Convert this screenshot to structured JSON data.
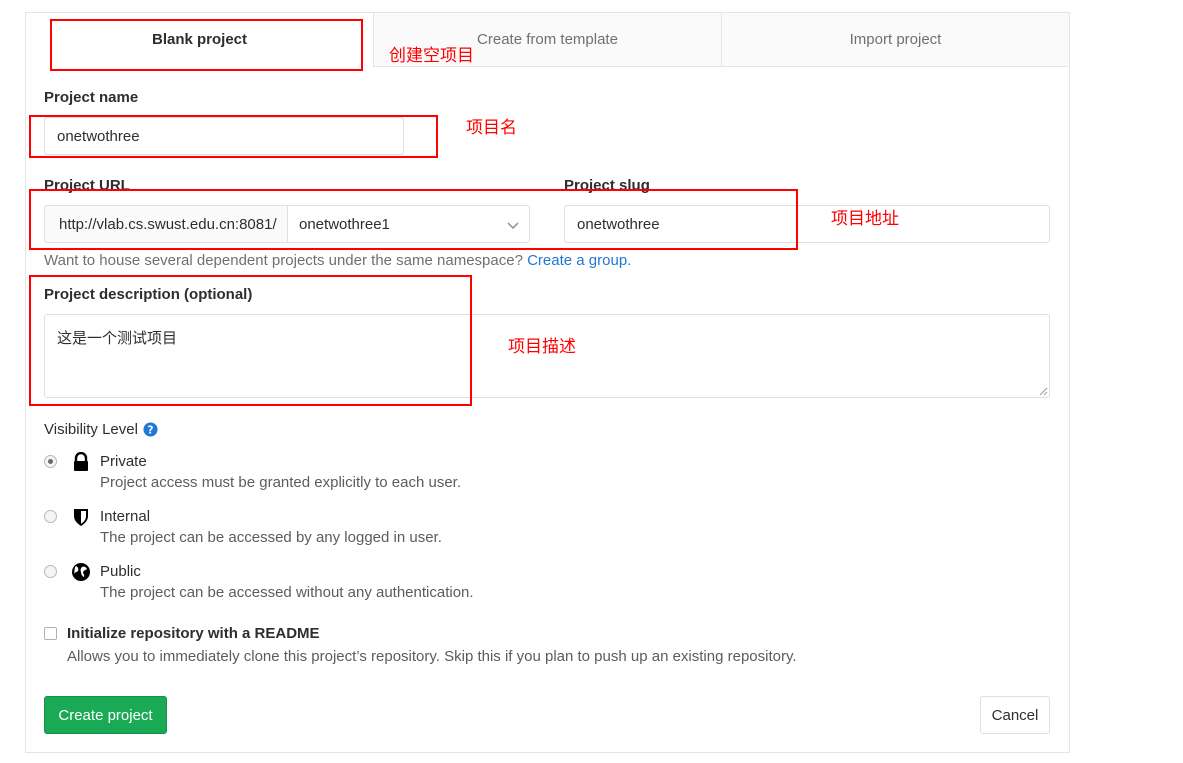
{
  "tabs": [
    {
      "label": "Blank project",
      "active": true
    },
    {
      "label": "Create from template",
      "active": false
    },
    {
      "label": "Import project",
      "active": false
    }
  ],
  "project_name": {
    "label": "Project name",
    "value": "onetwothree"
  },
  "project_url": {
    "label": "Project URL",
    "prefix": "http://vlab.cs.swust.edu.cn:8081/",
    "namespace": "onetwothree1"
  },
  "project_slug": {
    "label": "Project slug",
    "value": "onetwothree"
  },
  "namespace_help": {
    "text": "Want to house several dependent projects under the same namespace?",
    "link": "Create a group."
  },
  "description": {
    "label": "Project description (optional)",
    "value": "这是一个测试项目"
  },
  "visibility": {
    "label": "Visibility Level",
    "options": [
      {
        "title": "Private",
        "desc": "Project access must be granted explicitly to each user.",
        "icon": "lock-icon",
        "selected": true
      },
      {
        "title": "Internal",
        "desc": "The project can be accessed by any logged in user.",
        "icon": "shield-icon",
        "selected": false
      },
      {
        "title": "Public",
        "desc": "The project can be accessed without any authentication.",
        "icon": "globe-icon",
        "selected": false
      }
    ]
  },
  "readme": {
    "label": "Initialize repository with a README",
    "desc": "Allows you to immediately clone this project’s repository. Skip this if you plan to push up an existing repository.",
    "checked": false
  },
  "buttons": {
    "create": "Create project",
    "cancel": "Cancel"
  },
  "annotations": {
    "blank": "创建空项目",
    "name": "项目名",
    "url": "项目地址",
    "description": "项目描述"
  },
  "colors": {
    "primary": "#1aaa55",
    "link": "#1f78d1",
    "annotation": "#ff0000"
  }
}
